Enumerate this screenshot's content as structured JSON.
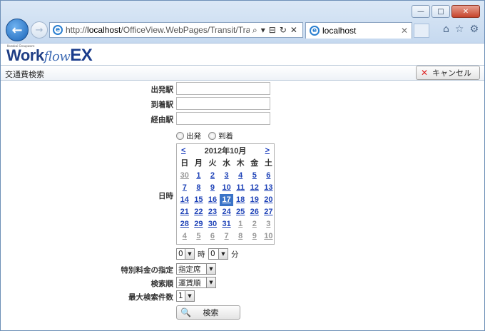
{
  "browser": {
    "url_prefix": "http://",
    "url_host": "localhost",
    "url_path": "/OfficeView.WebPages/Transit/Tran:",
    "tab_label": "localhost",
    "search_glyph": "⌕",
    "dropdown_glyph": "▾",
    "compat_glyph": "⊟",
    "refresh_glyph": "↻",
    "stop_glyph": "✕",
    "home_glyph": "⌂",
    "favorites_glyph": "☆",
    "tools_glyph": "⚙",
    "ie_glyph": "e",
    "back_glyph": "←",
    "forward_glyph": "→",
    "min_glyph": "—",
    "max_glyph": "□",
    "close_glyph": "✕",
    "tab_close_glyph": "✕"
  },
  "app": {
    "logo_small": "Kozakai Groupware",
    "logo_work": "Work",
    "logo_flow": "flow",
    "logo_ex": "EX"
  },
  "toolbar": {
    "title": "交通費検索",
    "cancel_label": "キャンセル",
    "cancel_glyph": "✕"
  },
  "form": {
    "departure_label": "出発駅",
    "arrival_label": "到着駅",
    "via_label": "経由駅",
    "departure_value": "",
    "arrival_value": "",
    "via_value": "",
    "radio_departure": "出発",
    "radio_arrival": "到着",
    "datetime_label": "日時",
    "hour_value": "0",
    "hour_unit": "時",
    "minute_value": "0",
    "minute_unit": "分",
    "special_fee_label": "特別料金の指定",
    "special_fee_value": "指定席",
    "sort_label": "検索順",
    "sort_value": "運賃順",
    "max_results_label": "最大検索件数",
    "max_results_value": "1",
    "search_label": "検索",
    "search_glyph": "🔍"
  },
  "calendar": {
    "prev": "<",
    "next": ">",
    "month_title": "2012年10月",
    "weekdays": [
      "日",
      "月",
      "火",
      "水",
      "木",
      "金",
      "土"
    ],
    "days": [
      {
        "d": "30",
        "other": true
      },
      {
        "d": "1"
      },
      {
        "d": "2"
      },
      {
        "d": "3"
      },
      {
        "d": "4"
      },
      {
        "d": "5"
      },
      {
        "d": "6"
      },
      {
        "d": "7"
      },
      {
        "d": "8"
      },
      {
        "d": "9"
      },
      {
        "d": "10"
      },
      {
        "d": "11"
      },
      {
        "d": "12"
      },
      {
        "d": "13"
      },
      {
        "d": "14"
      },
      {
        "d": "15"
      },
      {
        "d": "16"
      },
      {
        "d": "17",
        "today": true
      },
      {
        "d": "18"
      },
      {
        "d": "19"
      },
      {
        "d": "20"
      },
      {
        "d": "21"
      },
      {
        "d": "22"
      },
      {
        "d": "23"
      },
      {
        "d": "24"
      },
      {
        "d": "25"
      },
      {
        "d": "26"
      },
      {
        "d": "27"
      },
      {
        "d": "28"
      },
      {
        "d": "29"
      },
      {
        "d": "30"
      },
      {
        "d": "31"
      },
      {
        "d": "1",
        "other": true
      },
      {
        "d": "2",
        "other": true
      },
      {
        "d": "3",
        "other": true
      },
      {
        "d": "4",
        "other": true
      },
      {
        "d": "5",
        "other": true
      },
      {
        "d": "6",
        "other": true
      },
      {
        "d": "7",
        "other": true
      },
      {
        "d": "8",
        "other": true
      },
      {
        "d": "9",
        "other": true
      },
      {
        "d": "10",
        "other": true
      }
    ]
  }
}
